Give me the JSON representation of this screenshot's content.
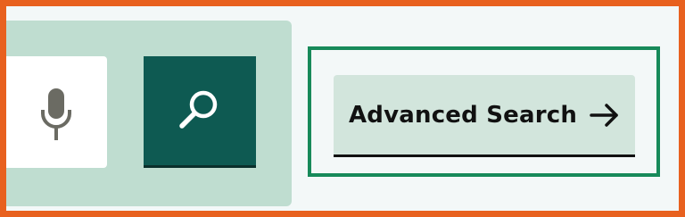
{
  "advanced_search": {
    "label": "Advanced Search"
  },
  "icons": {
    "microphone": "mic-icon",
    "search": "magnifier-icon",
    "arrow": "arrow-right-icon"
  },
  "colors": {
    "frame_border": "#e8611f",
    "panel_bg": "#bfddd0",
    "search_button_bg": "#0e5a52",
    "advanced_outline": "#178a5a",
    "advanced_button_bg": "#d2e5dc"
  }
}
